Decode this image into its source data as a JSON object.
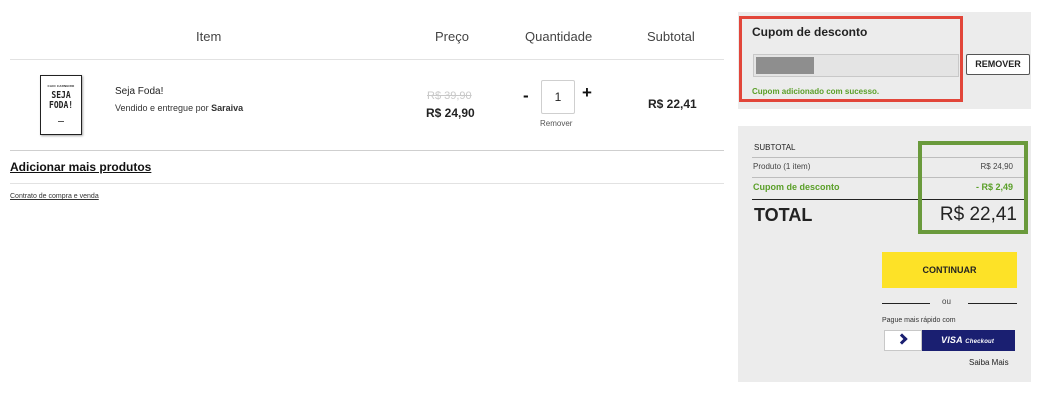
{
  "cart": {
    "headers": {
      "item": "Item",
      "price": "Preço",
      "quantity": "Quantidade",
      "subtotal": "Subtotal"
    },
    "items": [
      {
        "cover": {
          "top_text": "CAIO CARNEIRO",
          "title_line1": "SEJA",
          "title_line2": "FODA!"
        },
        "name": "Seja Foda!",
        "seller_prefix": "Vendido e entregue por",
        "seller": "Saraiva",
        "old_price": "R$ 39,90",
        "price": "R$ 24,90",
        "qty_minus": "-",
        "quantity": "1",
        "qty_plus": "+",
        "remove_label": "Remover",
        "subtotal": "R$ 22,41"
      }
    ],
    "add_more_label": "Adicionar mais produtos",
    "contract_label": "Contrato de compra e venda"
  },
  "coupon": {
    "title": "Cupom de desconto",
    "remove_label": "REMOVER",
    "success_message": "Cupom adicionado com sucesso."
  },
  "summary": {
    "label": "SUBTOTAL",
    "product_label": "Produto (1 item)",
    "product_value": "R$ 24,90",
    "discount_label": "Cupom de desconto",
    "discount_value": "- R$ 2,49",
    "total_label": "TOTAL",
    "total_value": "R$ 22,41",
    "continue_label": "CONTINUAR",
    "or_label": "ou",
    "fast_pay_label": "Pague mais rápido com",
    "visa_label": "VISA",
    "visa_suffix": "Checkout",
    "learn_more_label": "Saiba Mais"
  },
  "colors": {
    "highlight_red": "#e2463a",
    "highlight_green": "#6a9a3c",
    "success_green": "#5a9f28",
    "continue_yellow": "#fde227",
    "visa_blue": "#1a1f71",
    "panel_gray": "#ececec"
  },
  "icons": {
    "visa_logo": "chevron-right-icon"
  }
}
